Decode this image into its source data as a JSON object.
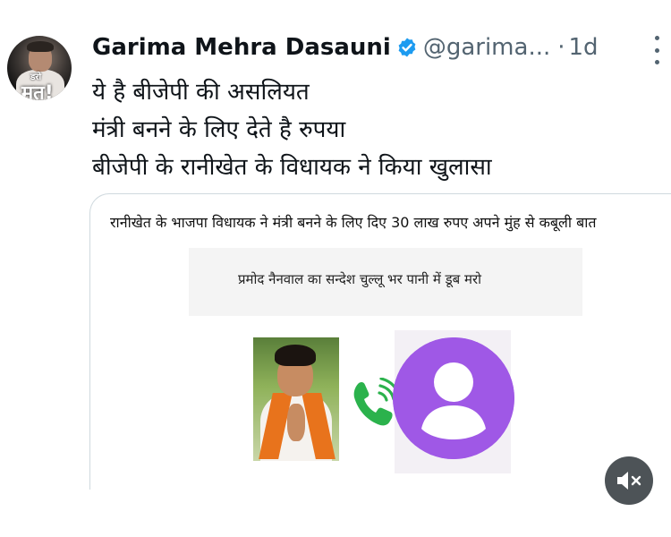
{
  "tweet": {
    "author_name": "Garima Mehra Dasauni",
    "handle": "@garima...",
    "separator": "·",
    "time": "1d",
    "avatar_badge": "मत!",
    "avatar_badge_small": "डरो",
    "lines": [
      "ये है बीजेपी की असलियत",
      "मंत्री बनने के लिए देते है रुपया",
      "बीजेपी के रानीखेत के विधायक ने किया खुलासा"
    ]
  },
  "media": {
    "headline": "रानीखेत के भाजपा विधायक ने मंत्री बनने के लिए दिए 30 लाख  रुपए अपने मुंह से कबूली बात",
    "subline": "प्रमोद नैनवाल का सन्देश चुल्लू भर पानी में डूब मरो"
  },
  "icons": {
    "verified": "verified-badge-icon",
    "more": "more-options-icon",
    "phone": "phone-call-icon",
    "contact": "contact-avatar-icon",
    "mute": "speaker-muted-icon"
  },
  "colors": {
    "verified": "#1d9bf0",
    "secondary_text": "#536471",
    "phone_green": "#2bb24c",
    "contact_purple": "#9f58e6",
    "scarf_orange": "#e8731c"
  }
}
